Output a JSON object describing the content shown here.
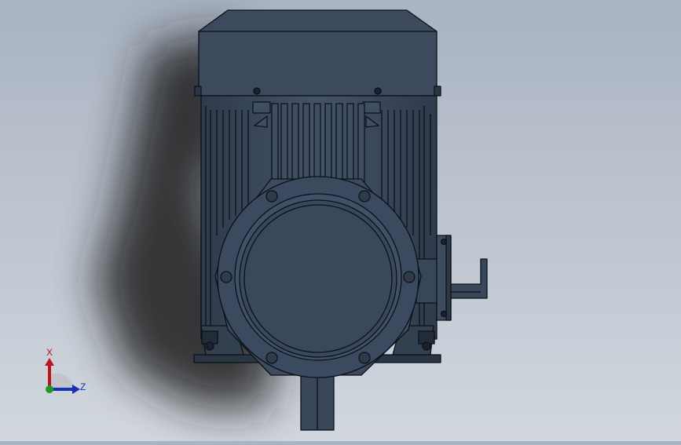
{
  "viewport": {
    "background_top": "#a9b3c1",
    "background_bottom": "#d2d7de",
    "model_color": "#3c4a5c",
    "edge_color": "#0c1118",
    "shadow_color": "#1b1c1f"
  },
  "triad": {
    "x_label": "X",
    "z_label": "Z",
    "x_color": "#c0121b",
    "z_color": "#1a2fb8",
    "y_color": "#1a9a22"
  }
}
